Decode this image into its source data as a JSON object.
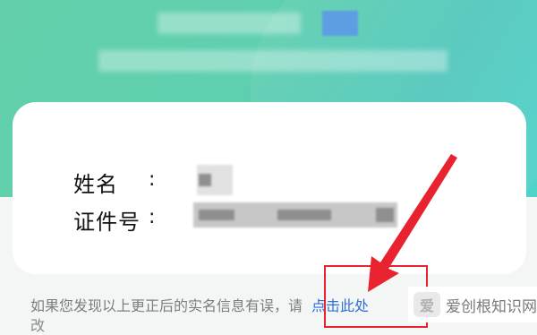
{
  "card": {
    "name_label": "姓名",
    "id_label": "证件号",
    "colon": ":"
  },
  "notice": {
    "text": "如果您发现以上更正后的实名信息有误，请",
    "link_text": "点击此处",
    "line2": "改"
  },
  "watermark": {
    "logo_text": "爱",
    "text": "爱创根知识网"
  },
  "colors": {
    "header_gradient_start": "#63cfaa",
    "header_gradient_end": "#4fd3c9",
    "link": "#2f6fd6",
    "highlight_red": "#e8232f"
  },
  "icons": {
    "annotation": "red-arrow-icon"
  }
}
